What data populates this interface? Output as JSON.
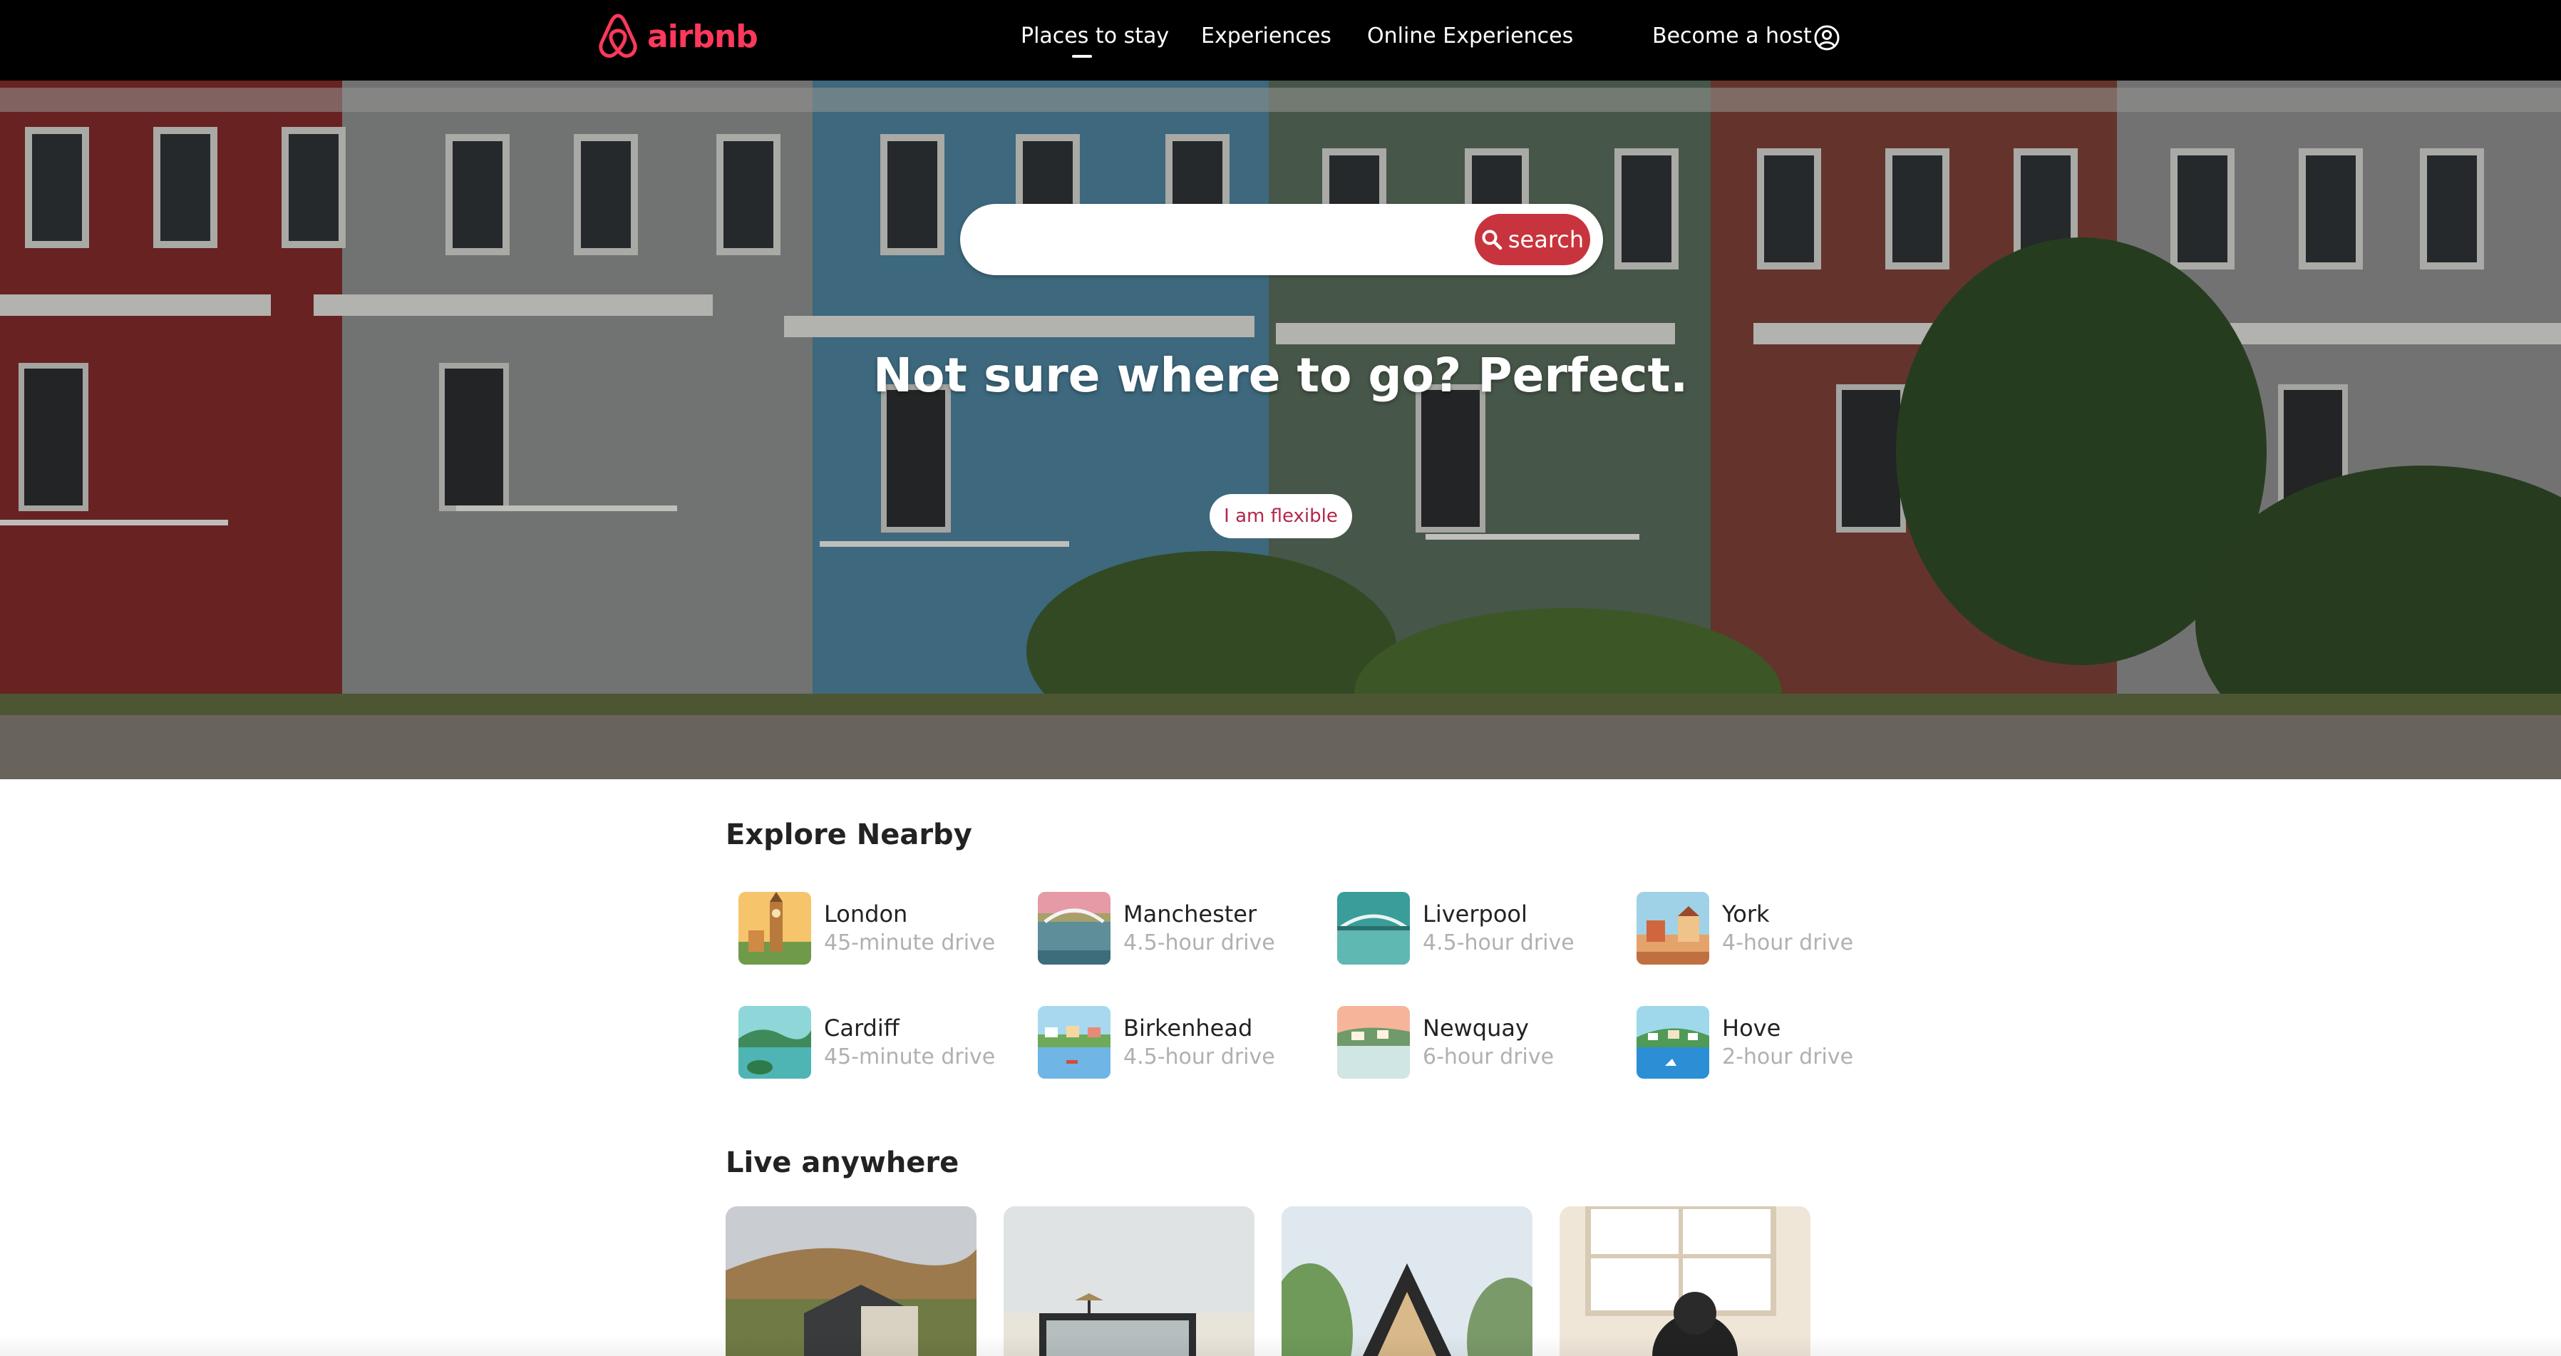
{
  "brand": {
    "name": "airbnb",
    "accent_color": "#ff385c",
    "search_color": "#c8343d"
  },
  "nav": {
    "links": [
      "Places to stay",
      "Experiences",
      "Online Experiences"
    ],
    "active": "Places to stay",
    "host_label": "Become a host",
    "user_icon": "user-circle-icon"
  },
  "hero": {
    "search": {
      "placeholder": "",
      "value": "",
      "button_label": "search",
      "button_icon": "magnifier-icon"
    },
    "title": "Not sure where to go? Perfect.",
    "flexible_label": "I am flexible"
  },
  "explore": {
    "title": "Explore Nearby",
    "places": [
      {
        "name": "London",
        "time": "45-minute drive"
      },
      {
        "name": "Manchester",
        "time": "4.5-hour drive"
      },
      {
        "name": "Liverpool",
        "time": "4.5-hour drive"
      },
      {
        "name": "York",
        "time": "4-hour drive"
      },
      {
        "name": "Cardiff",
        "time": "45-minute drive"
      },
      {
        "name": "Birkenhead",
        "time": "4.5-hour drive"
      },
      {
        "name": "Newquay",
        "time": "6-hour drive"
      },
      {
        "name": "Hove",
        "time": "2-hour drive"
      }
    ]
  },
  "live": {
    "title": "Live anywhere",
    "cards": [
      "hillside-cabin-image",
      "modern-beach-house-image",
      "a-frame-cabin-image",
      "dog-in-home-image"
    ]
  }
}
